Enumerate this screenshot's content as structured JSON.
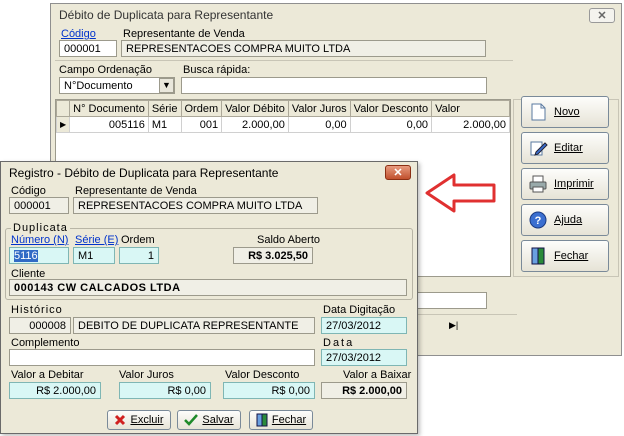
{
  "back_window": {
    "title": "Débito de Duplicata para Representante",
    "codigo_label": "Código",
    "codigo_value": "000001",
    "rep_label": "Representante de Venda",
    "rep_value": "REPRESENTACOES COMPRA MUITO LTDA",
    "ordenacao_label": "Campo Ordenação",
    "ordenacao_value": "N°Documento",
    "busca_label": "Busca rápida:",
    "busca_value": "",
    "grid": {
      "headers": [
        "N° Documento",
        "Série",
        "Ordem",
        "Valor Débito",
        "Valor Juros",
        "Valor Desconto",
        "Valor"
      ],
      "rows": [
        [
          "005116",
          "M1",
          "001",
          "2.000,00",
          "0,00",
          "0,00",
          "2.000,00"
        ]
      ]
    },
    "buttons": {
      "novo": "Novo",
      "editar": "Editar",
      "imprimir": "Imprimir",
      "ajuda": "Ajuda",
      "fechar": "Fechar"
    },
    "nav_next": "▶|"
  },
  "front_window": {
    "title": "Registro - Débito de Duplicata para Representante",
    "codigo_label": "Código",
    "codigo_value": "000001",
    "rep_label": "Representante de Venda",
    "rep_value": "REPRESENTACOES COMPRA MUITO LTDA",
    "duplicata_group": "Duplicata",
    "numero_label": "Número (N)",
    "numero_value": "5116",
    "serie_label": "Série (E)",
    "serie_value": "M1",
    "ordem_label": "Ordem",
    "ordem_value": "1",
    "saldo_label": "Saldo Aberto",
    "saldo_value": "R$ 3.025,50",
    "cliente_label": "Cliente",
    "cliente_value": "000143  CW CALCADOS LTDA",
    "historico_label": "Histórico",
    "historico_code": "000008",
    "historico_value": "DEBITO DE DUPLICATA REPRESENTANTE",
    "data_dig_label": "Data Digitação",
    "data_dig_value": "27/03/2012",
    "complemento_label": "Complemento",
    "complemento_value": "",
    "data_label": "Data",
    "data_value": "27/03/2012",
    "valor_debitar_label": "Valor a Debitar",
    "valor_debitar_value": "R$ 2.000,00",
    "valor_juros_label": "Valor Juros",
    "valor_juros_value": "R$ 0,00",
    "valor_desconto_label": "Valor Desconto",
    "valor_desconto_value": "R$ 0,00",
    "valor_baixar_label": "Valor a Baixar",
    "valor_baixar_value": "R$ 2.000,00",
    "buttons": {
      "excluir": "Excluir",
      "salvar": "Salvar",
      "fechar": "Fechar"
    }
  },
  "colors": {
    "arrow": "#e03030",
    "cyan_field": "#d9f7f5"
  }
}
